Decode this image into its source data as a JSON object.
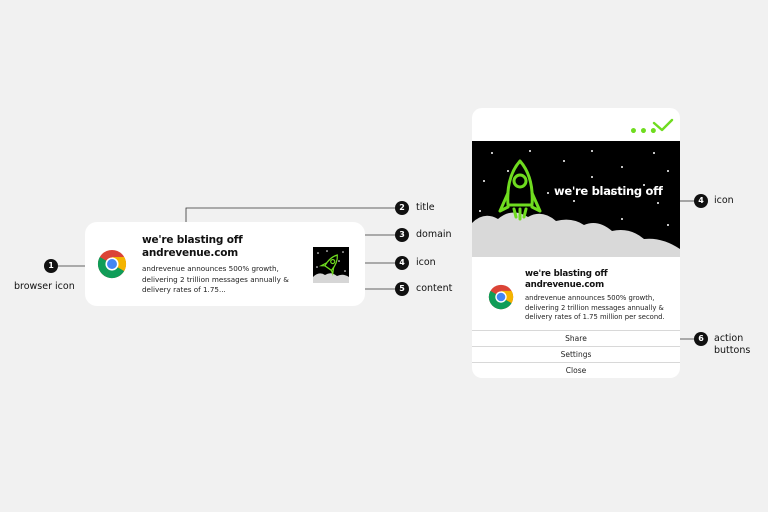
{
  "desktop_notification": {
    "title": "we're blasting off",
    "domain": "andrevenue.com",
    "content": "andrevenue announces 500% growth, delivering 2 trillion messages annually & delivery rates of 1.75..."
  },
  "mobile_notification": {
    "dots": "•••",
    "hero_text": "we're blasting off",
    "title": "we're blasting off",
    "domain": "andrevenue.com",
    "content": "andrevenue announces 500% growth, delivering 2 trillion messages annually & delivery rates of 1.75 million per second.",
    "buttons": [
      "Share",
      "Settings",
      "Close"
    ]
  },
  "callouts": [
    {
      "number": "1",
      "label": "browser icon"
    },
    {
      "number": "2",
      "label": "title"
    },
    {
      "number": "3",
      "label": "domain"
    },
    {
      "number": "4",
      "label": "icon"
    },
    {
      "number": "5",
      "label": "content"
    },
    {
      "number": "4",
      "label": "icon"
    },
    {
      "number": "6",
      "label": "action buttons"
    }
  ],
  "colors": {
    "background": "#f1f1f1",
    "accent_green": "#6fdc1f",
    "callout_badge": "#111111"
  }
}
